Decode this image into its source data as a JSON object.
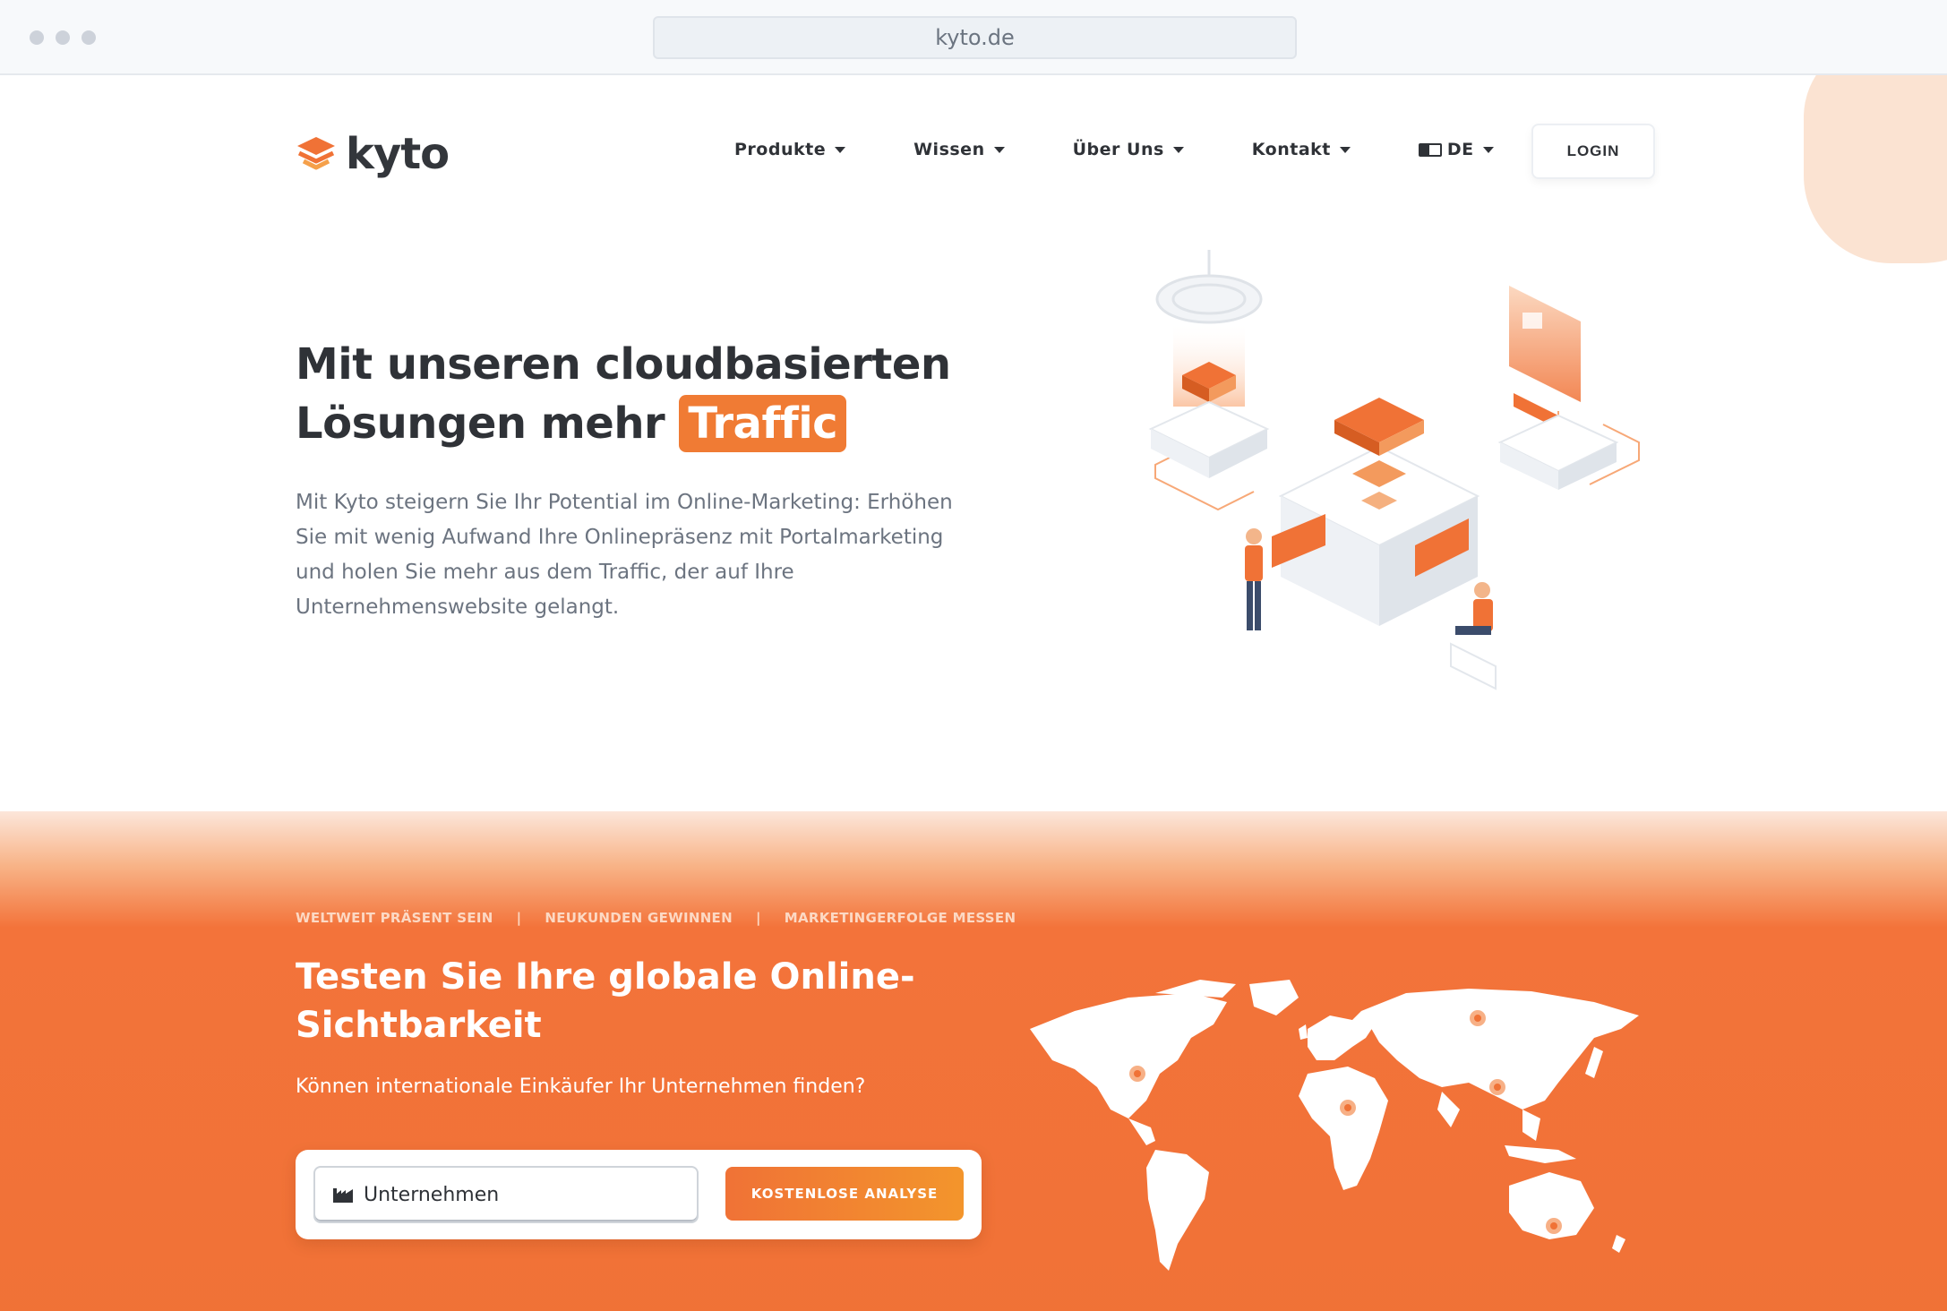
{
  "browser": {
    "url": "kyto.de"
  },
  "header": {
    "logo_text": "kyto",
    "nav": [
      {
        "label": "Produkte"
      },
      {
        "label": "Wissen"
      },
      {
        "label": "Über Uns"
      },
      {
        "label": "Kontakt"
      },
      {
        "label": "DE"
      }
    ],
    "login_label": "LOGIN"
  },
  "hero": {
    "title_line1": "Mit unseren cloudbasierten",
    "title_line2": "Lösungen mehr",
    "title_highlight": "Traffic",
    "description": "Mit Kyto steigern Sie Ihr Potential im Online-Marketing: Erhöhen Sie mit wenig Aufwand Ihre Onlinepräsenz mit Portalmarketing und holen Sie mehr aus dem Traffic, der auf Ihre Unternehmenswebsite gelangt."
  },
  "analysis": {
    "taglines": [
      "WELTWEIT PRÄSENT SEIN",
      "NEUKUNDEN GEWINNEN",
      "MARKETINGERFOLGE MESSEN"
    ],
    "separator": "|",
    "title": "Testen Sie Ihre globale Online-Sichtbarkeit",
    "subtitle": "Können internationale Einkäufer Ihr Unternehmen finden?",
    "input_placeholder": "Unternehmen",
    "cta_label": "KOSTENLOSE ANALYSE"
  },
  "colors": {
    "accent": "#f07236",
    "text": "#2f3237",
    "muted": "#6c7480"
  }
}
